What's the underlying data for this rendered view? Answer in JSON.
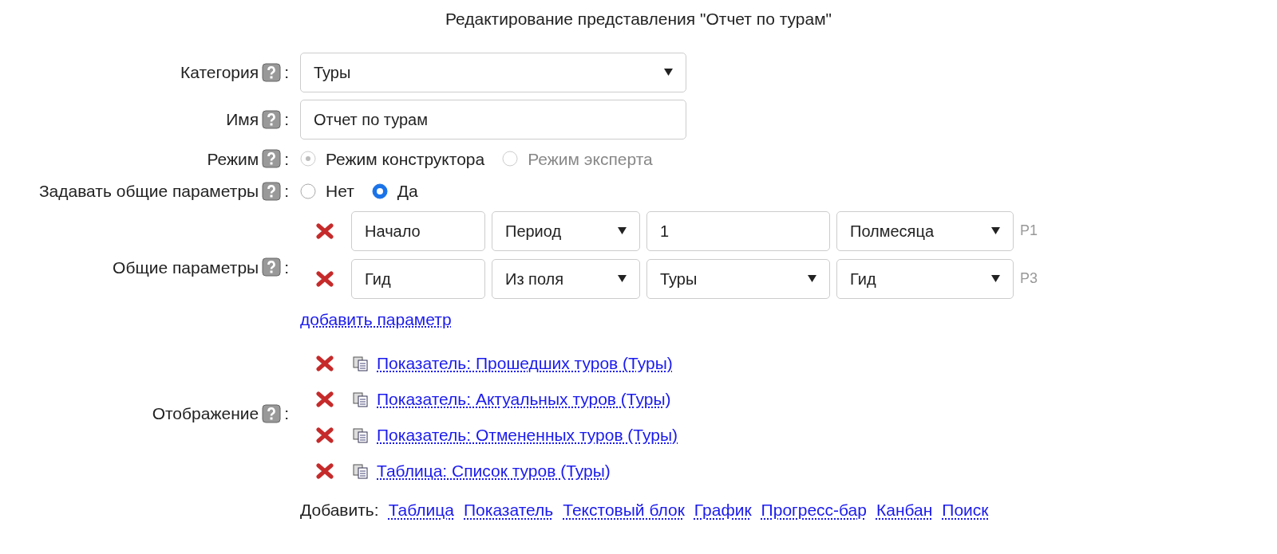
{
  "title": "Редактирование представления \"Отчет по турам\"",
  "category": {
    "label": "Категория",
    "separator": ":",
    "value": "Туры"
  },
  "name": {
    "label": "Имя",
    "separator": ":",
    "value": "Отчет по турам"
  },
  "mode": {
    "label": "Режим",
    "separator": ":",
    "options": [
      {
        "label": "Режим конструктора",
        "selected": true,
        "disabled": true
      },
      {
        "label": "Режим эксперта",
        "selected": false,
        "disabled": true
      }
    ]
  },
  "common": {
    "label": "Задавать общие параметры",
    "separator": ":",
    "options": [
      {
        "label": "Нет",
        "selected": false,
        "disabled": false
      },
      {
        "label": "Да",
        "selected": true,
        "disabled": false
      }
    ]
  },
  "params": {
    "label": "Общие параметры",
    "separator": ":",
    "rows": [
      {
        "tag": "P1",
        "cells": [
          {
            "kind": "input",
            "value": "Начало"
          },
          {
            "kind": "select",
            "value": "Период"
          },
          {
            "kind": "input",
            "value": "1"
          },
          {
            "kind": "select",
            "value": "Полмесяца"
          }
        ]
      },
      {
        "tag": "P3",
        "cells": [
          {
            "kind": "input",
            "value": "Гид"
          },
          {
            "kind": "select",
            "value": "Из поля"
          },
          {
            "kind": "select",
            "value": "Туры"
          },
          {
            "kind": "select",
            "value": "Гид"
          }
        ]
      }
    ],
    "add_link": "добавить параметр"
  },
  "display": {
    "label": "Отображение",
    "separator": ":",
    "items": [
      {
        "text": "Показатель: Прошедших туров (Туры)"
      },
      {
        "text": "Показатель: Актуальных туров (Туры)"
      },
      {
        "text": "Показатель: Отмененных туров (Туры)"
      },
      {
        "text": "Таблица: Список туров (Туры)"
      }
    ]
  },
  "add": {
    "label": "Добавить:",
    "links": [
      "Таблица",
      "Показатель",
      "Текстовый блок",
      "График",
      "Прогресс-бар",
      "Канбан",
      "Поиск"
    ]
  }
}
